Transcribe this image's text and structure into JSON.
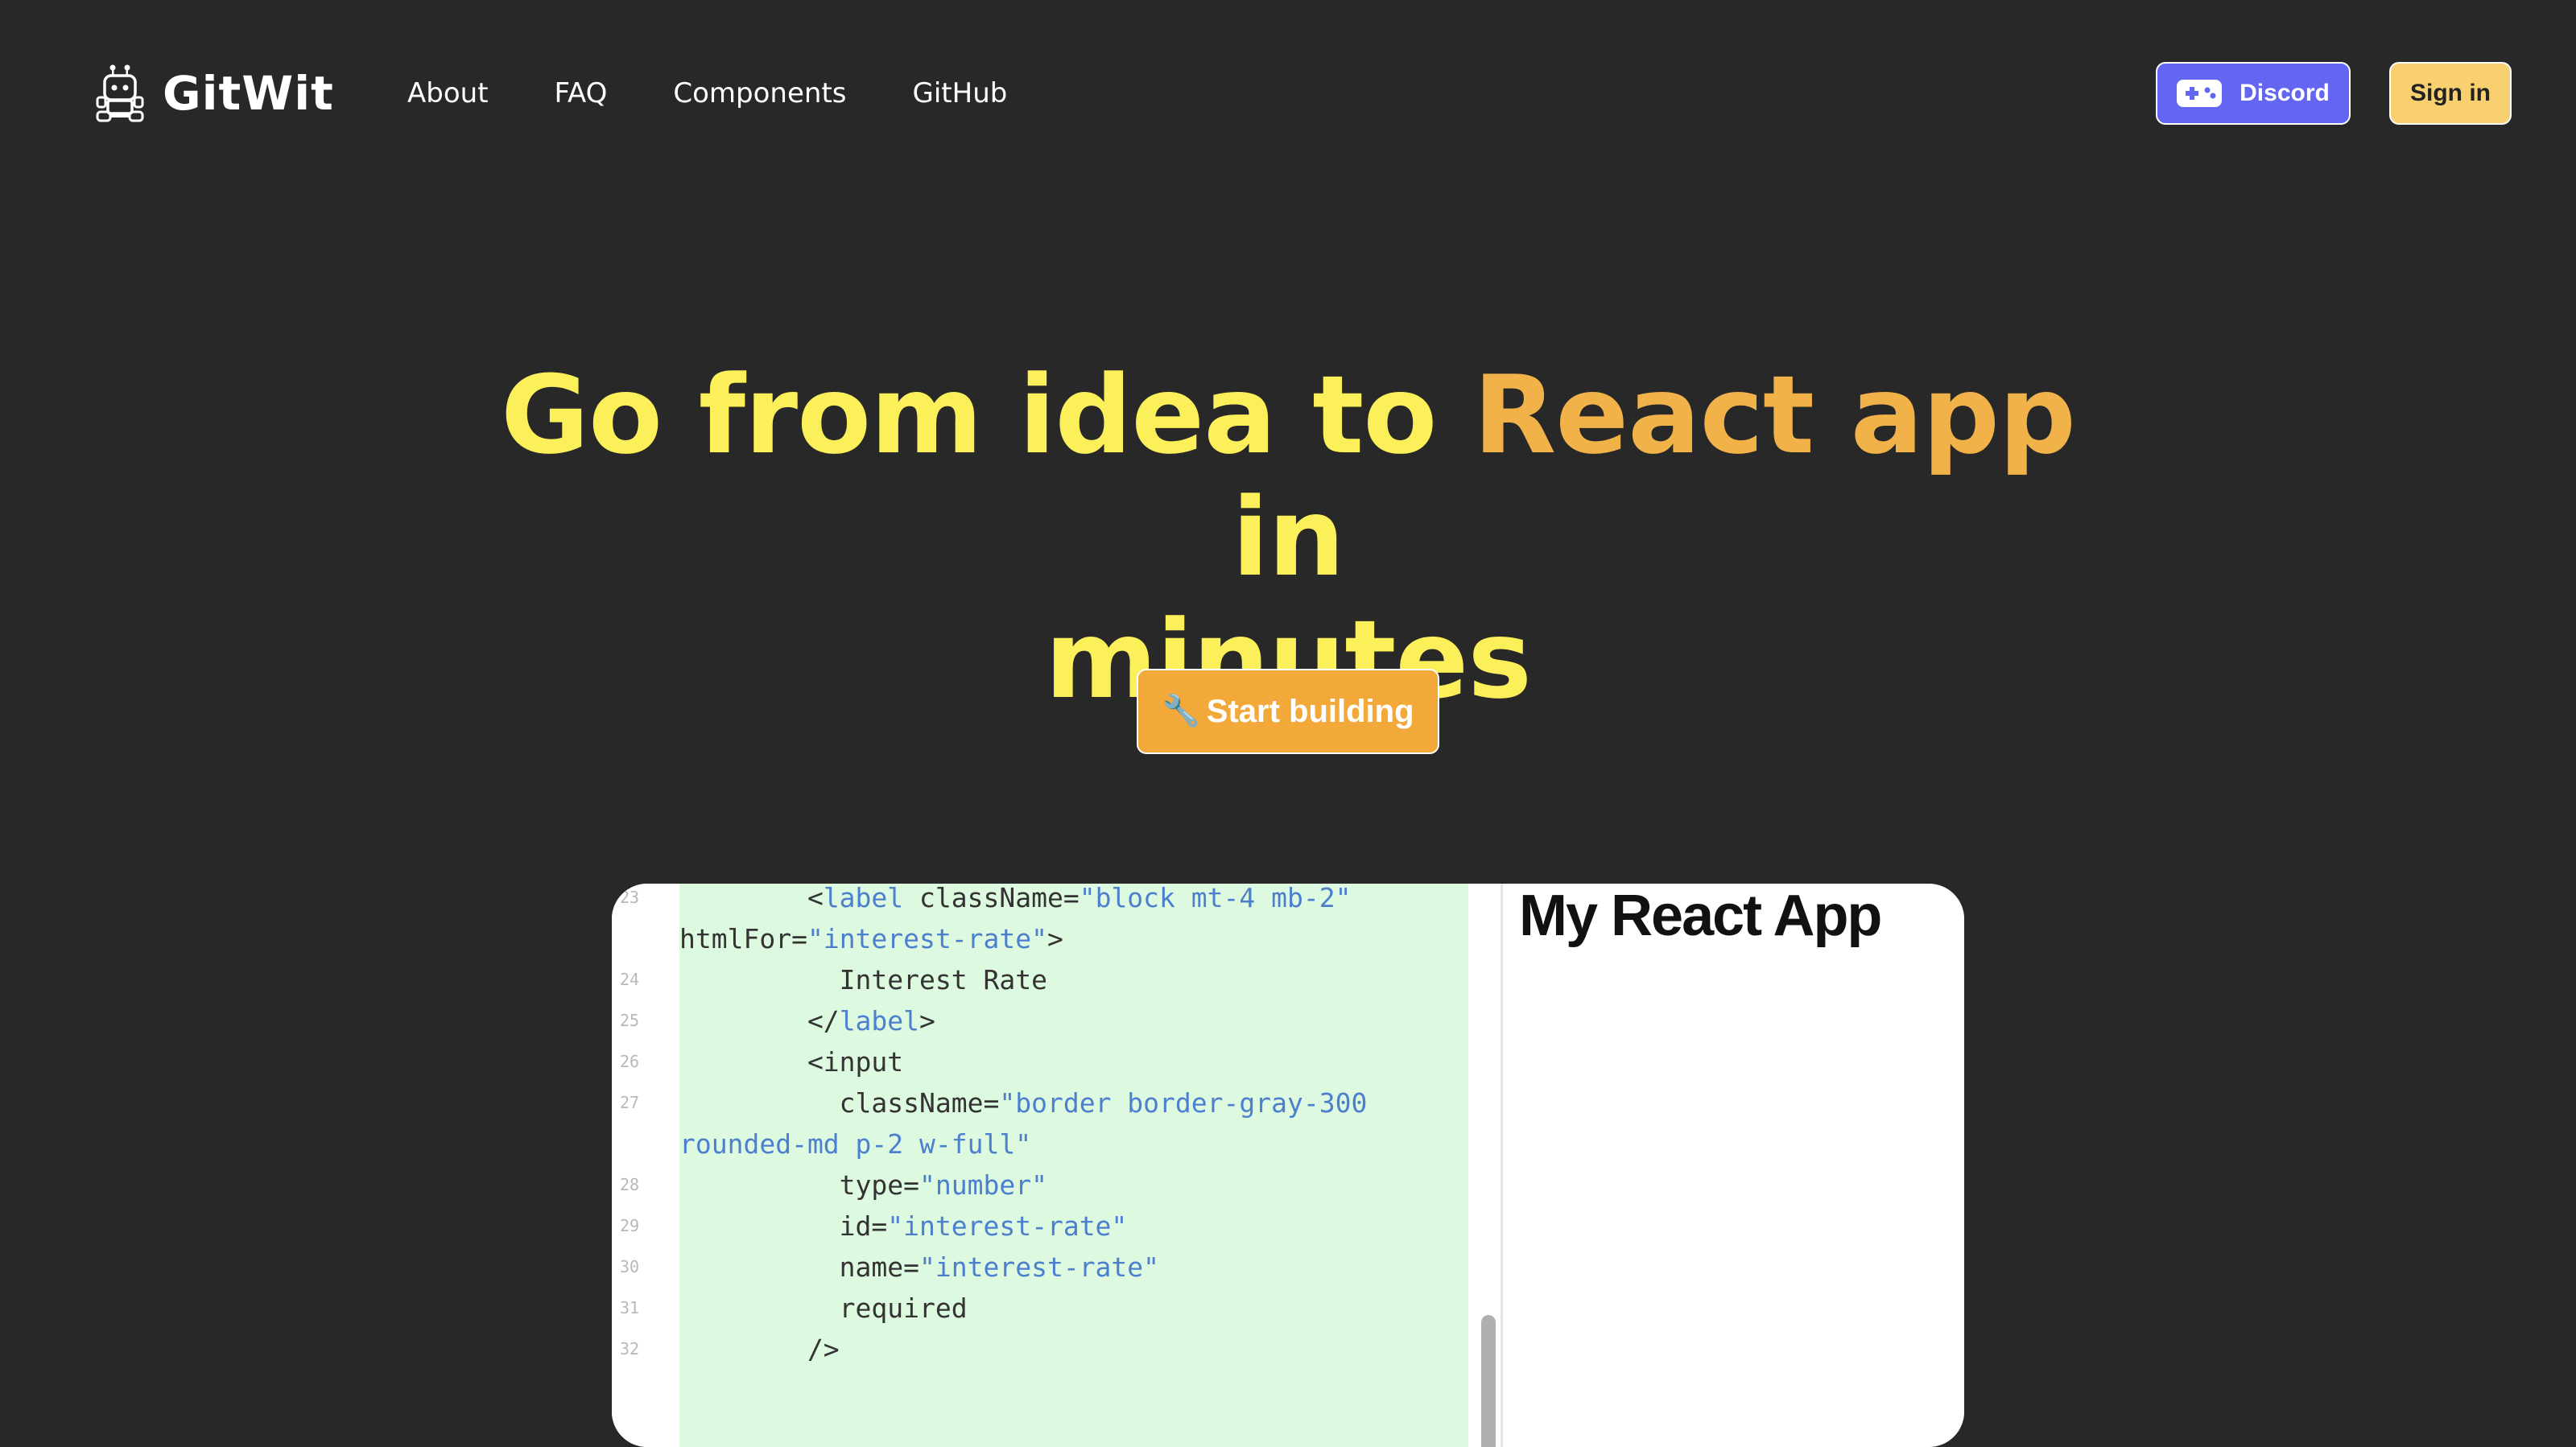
{
  "brand": {
    "name": "GitWit",
    "logo_icon": "robot-icon"
  },
  "nav": {
    "items": [
      {
        "label": "About"
      },
      {
        "label": "FAQ"
      },
      {
        "label": "Components"
      },
      {
        "label": "GitHub"
      }
    ]
  },
  "actions": {
    "discord_label": "Discord",
    "discord_icon": "gamepad-icon",
    "signin_label": "Sign in"
  },
  "hero": {
    "title_part1": "Go from idea to ",
    "title_highlight": "React app",
    "title_part2": " in",
    "title_line2": "minutes",
    "cta_icon": "🔧",
    "cta_label": "Start building"
  },
  "colors": {
    "background": "#282828",
    "headline_yellow": "#fcf05a",
    "headline_orange": "#f2b24a",
    "discord": "#6366f1",
    "signin": "#f9d06f",
    "cta": "#f2a93a",
    "code_bg": "#ddf9e0"
  },
  "editor": {
    "lines": [
      {
        "num": "23",
        "parts": [
          [
            "p",
            "  <"
          ],
          [
            "t",
            "label"
          ],
          [
            "p",
            " className="
          ],
          [
            "s",
            "\"block mt-4 mb-2\""
          ]
        ]
      },
      {
        "num": "",
        "parts": [
          [
            "p",
            "htmlFor="
          ],
          [
            "s",
            "\"interest-rate\""
          ],
          [
            "p",
            ">"
          ]
        ]
      },
      {
        "num": "24",
        "parts": [
          [
            "p",
            "    Interest Rate"
          ]
        ]
      },
      {
        "num": "25",
        "parts": [
          [
            "p",
            "  </"
          ],
          [
            "t",
            "label"
          ],
          [
            "p",
            ">"
          ]
        ]
      },
      {
        "num": "26",
        "parts": [
          [
            "p",
            "  <input"
          ]
        ]
      },
      {
        "num": "27",
        "parts": [
          [
            "p",
            "    className="
          ],
          [
            "s",
            "\"border border-gray-300"
          ]
        ]
      },
      {
        "num": "",
        "parts": [
          [
            "s",
            "rounded-md p-2 w-full\""
          ]
        ]
      },
      {
        "num": "28",
        "parts": [
          [
            "p",
            "    type="
          ],
          [
            "s",
            "\"number\""
          ]
        ]
      },
      {
        "num": "29",
        "parts": [
          [
            "p",
            "    id="
          ],
          [
            "s",
            "\"interest-rate\""
          ]
        ]
      },
      {
        "num": "30",
        "parts": [
          [
            "p",
            "    name="
          ],
          [
            "s",
            "\"interest-rate\""
          ]
        ]
      },
      {
        "num": "31",
        "parts": [
          [
            "p",
            "    required"
          ]
        ]
      },
      {
        "num": "32",
        "parts": [
          [
            "p",
            "  />"
          ]
        ]
      }
    ]
  },
  "app_preview": {
    "title": "My React App"
  }
}
